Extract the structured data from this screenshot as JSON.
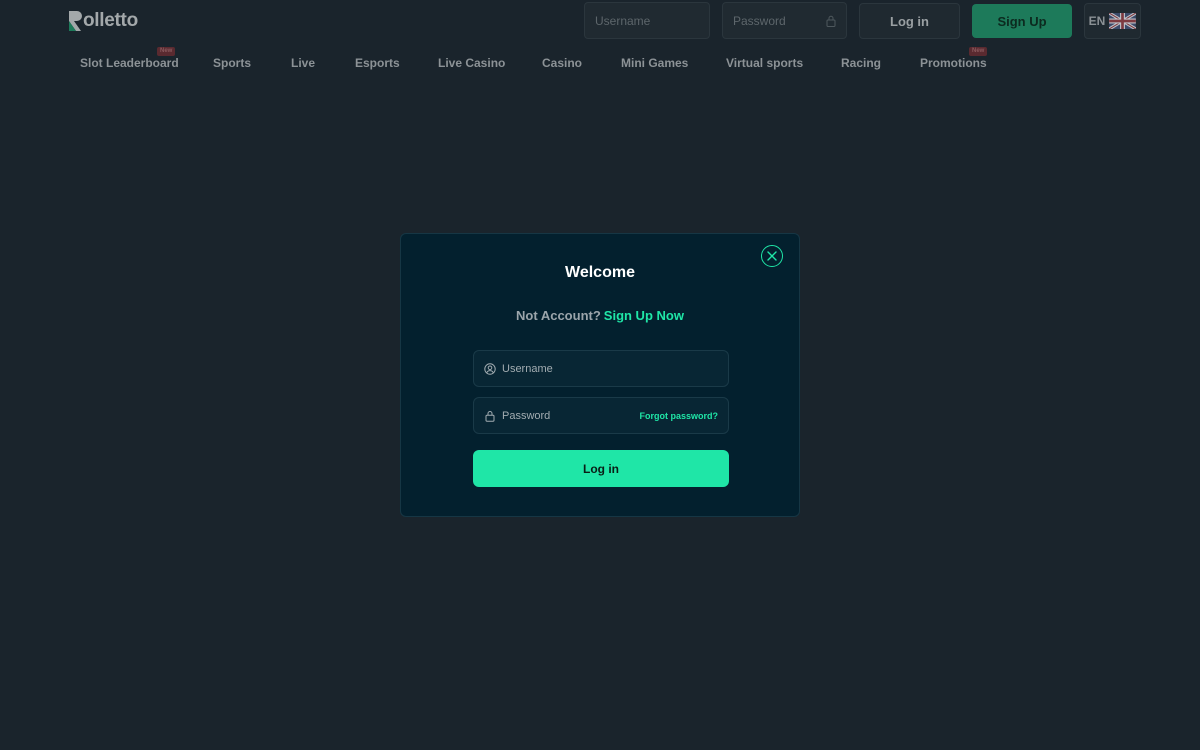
{
  "header": {
    "logo_text": "olletto",
    "username_placeholder": "Username",
    "password_placeholder": "Password",
    "login_label": "Log in",
    "signup_label": "Sign Up",
    "language": "EN"
  },
  "nav": {
    "items": [
      {
        "label": "Slot Leaderboard",
        "badge": "New"
      },
      {
        "label": "Sports"
      },
      {
        "label": "Live"
      },
      {
        "label": "Esports"
      },
      {
        "label": "Live Casino"
      },
      {
        "label": "Casino"
      },
      {
        "label": "Mini Games"
      },
      {
        "label": "Virtual sports"
      },
      {
        "label": "Racing"
      },
      {
        "label": "Promotions",
        "badge": "New"
      }
    ]
  },
  "modal": {
    "title": "Welcome",
    "no_account_text": "Not Account?",
    "signup_link": "Sign Up Now",
    "username_placeholder": "Username",
    "password_placeholder": "Password",
    "forgot_password": "Forgot password?",
    "login_button": "Log in"
  },
  "colors": {
    "background": "#1a242c",
    "modal_bg": "#03202e",
    "accent": "#1fe6a7",
    "signup_header_bg": "#1d7a5a"
  },
  "icons": [
    "rolletto-logo-icon",
    "lock-icon",
    "uk-flag-icon",
    "close-icon",
    "user-icon"
  ]
}
